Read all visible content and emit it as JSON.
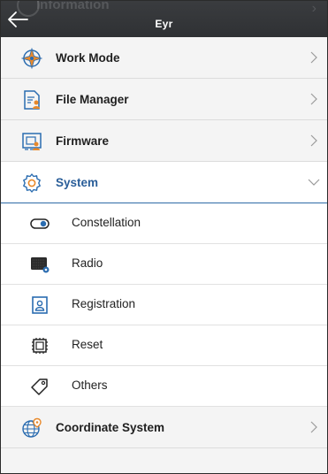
{
  "header": {
    "title": "Eyr",
    "partially_hidden_item": "Information"
  },
  "menu": [
    {
      "label": "Work Mode",
      "icon": "compass-icon"
    },
    {
      "label": "File Manager",
      "icon": "file-manager-icon"
    },
    {
      "label": "Firmware",
      "icon": "firmware-icon"
    },
    {
      "label": "System",
      "icon": "gear-icon",
      "expanded": true
    }
  ],
  "system_submenu": [
    {
      "label": "Constellation",
      "icon": "toggle-icon"
    },
    {
      "label": "Radio",
      "icon": "radio-icon"
    },
    {
      "label": "Registration",
      "icon": "registration-icon"
    },
    {
      "label": "Reset",
      "icon": "reset-chip-icon"
    },
    {
      "label": "Others",
      "icon": "tag-icon"
    }
  ],
  "after_menu": [
    {
      "label": "Coordinate System",
      "icon": "globe-pin-icon"
    }
  ],
  "colors": {
    "header_bg": "#2f3134",
    "accent": "#2a5e99",
    "icon_orange": "#e8892b",
    "icon_blue": "#2a6cb0"
  }
}
